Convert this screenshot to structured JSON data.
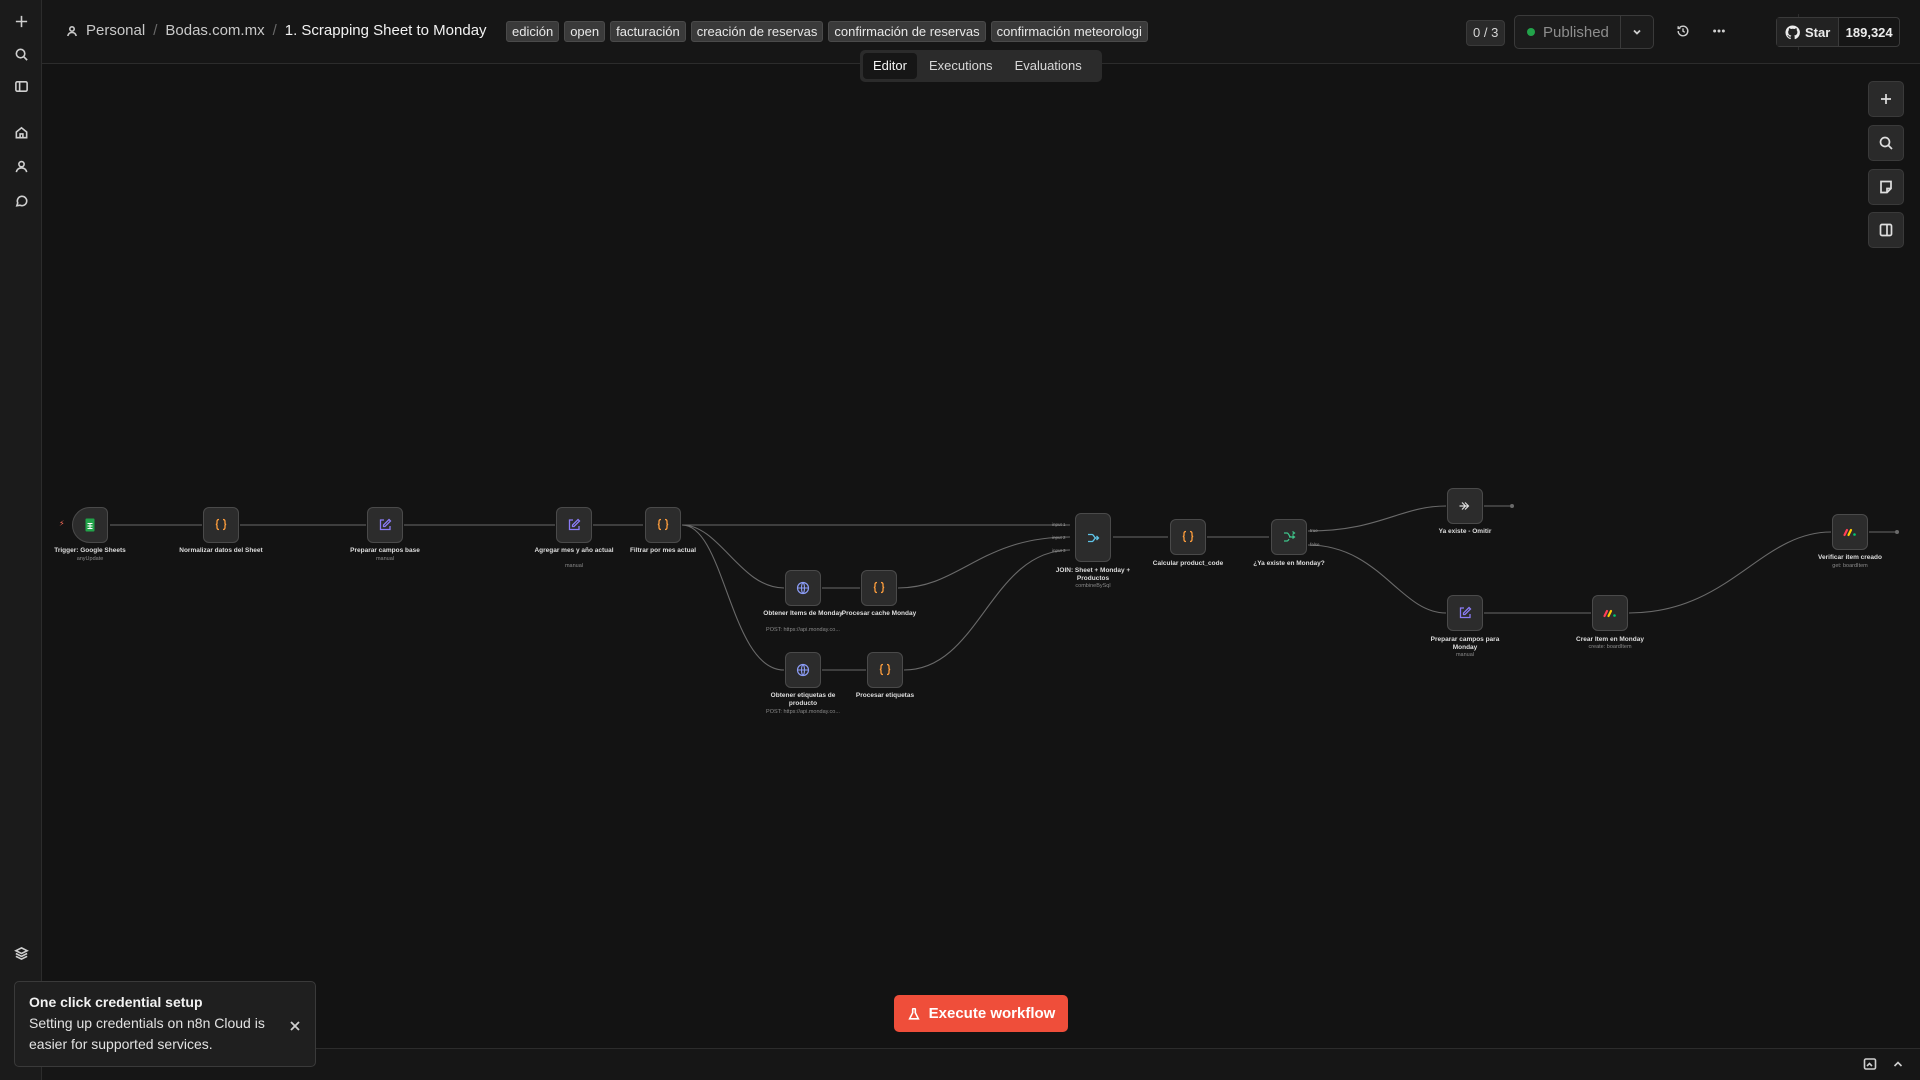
{
  "breadcrumb": {
    "project": "Personal",
    "folder": "Bodas.com.mx",
    "workflow_title": "1. Scrapping Sheet to Monday"
  },
  "tags": [
    "edición",
    "open",
    "facturación",
    "creación de reservas",
    "confirmación de reservas",
    "confirmación meteorologi"
  ],
  "counter": "0 / 3",
  "publish": {
    "label": "Published",
    "status_color": "#22a34a"
  },
  "github": {
    "label": "Star",
    "count": "189,324"
  },
  "tabs": {
    "editor": "Editor",
    "executions": "Executions",
    "evaluations": "Evaluations"
  },
  "nodes": [
    {
      "id": "trigger",
      "title": "Trigger: Google Sheets",
      "subtitle": "anyUpdate",
      "icon": "google-sheets-icon",
      "color": "#22a34a"
    },
    {
      "id": "normalize",
      "title": "Normalizar datos del Sheet",
      "subtitle": "",
      "icon": "code-icon",
      "color": "#ff9e3d"
    },
    {
      "id": "prep_base",
      "title": "Preparar campos base",
      "subtitle": "manual",
      "icon": "edit-icon",
      "color": "#8b7cf6"
    },
    {
      "id": "add_month",
      "title": "Agregar mes y año actual",
      "subtitle": "manual",
      "icon": "edit-icon",
      "color": "#8b7cf6"
    },
    {
      "id": "filter_month",
      "title": "Filtrar por mes actual",
      "subtitle": "",
      "icon": "code-icon",
      "color": "#ff9e3d"
    },
    {
      "id": "get_items",
      "title": "Obtener Items de Monday",
      "subtitle": "POST: https://api.monday.co...",
      "icon": "globe-icon",
      "color": "#8b9cf6"
    },
    {
      "id": "proc_cache",
      "title": "Procesar cache Monday",
      "subtitle": "",
      "icon": "code-icon",
      "color": "#ff9e3d"
    },
    {
      "id": "get_tags",
      "title": "Obtener etiquetas de producto",
      "subtitle": "POST: https://api.monday.co...",
      "icon": "globe-icon",
      "color": "#8b9cf6"
    },
    {
      "id": "proc_tags",
      "title": "Procesar etiquetas",
      "subtitle": "",
      "icon": "code-icon",
      "color": "#ff9e3d"
    },
    {
      "id": "join",
      "title": "JOIN: Sheet + Monday + Productos",
      "subtitle": "combineBySql",
      "icon": "merge-icon",
      "color": "#5fc4e8"
    },
    {
      "id": "calc_code",
      "title": "Calcular product_code",
      "subtitle": "",
      "icon": "code-icon",
      "color": "#ff9e3d"
    },
    {
      "id": "exists",
      "title": "¿Ya existe en Monday?",
      "subtitle": "",
      "icon": "if-icon",
      "color": "#3ec48a"
    },
    {
      "id": "skip",
      "title": "Ya existe - Omitir",
      "subtitle": "",
      "icon": "arrow-right-icon",
      "color": "#dedede"
    },
    {
      "id": "prep_monday",
      "title": "Preparar campos para Monday",
      "subtitle": "manual",
      "icon": "edit-icon",
      "color": "#8b7cf6"
    },
    {
      "id": "create_item",
      "title": "Crear Item en Monday",
      "subtitle": "create: boardItem",
      "icon": "monday-icon",
      "color": "#ff3d57"
    },
    {
      "id": "verify_item",
      "title": "Verificar item creado",
      "subtitle": "get: boardItem",
      "icon": "monday-icon",
      "color": "#ff3d57"
    }
  ],
  "port_labels": {
    "join_in1": "input 1",
    "join_in2": "input 2",
    "join_in3": "input 3",
    "if_true": "true",
    "if_false": "false"
  },
  "execute_button": {
    "label": "Execute workflow"
  },
  "toast": {
    "title": "One click credential setup",
    "body": "Setting up credentials on n8n Cloud is easier for supported services."
  }
}
